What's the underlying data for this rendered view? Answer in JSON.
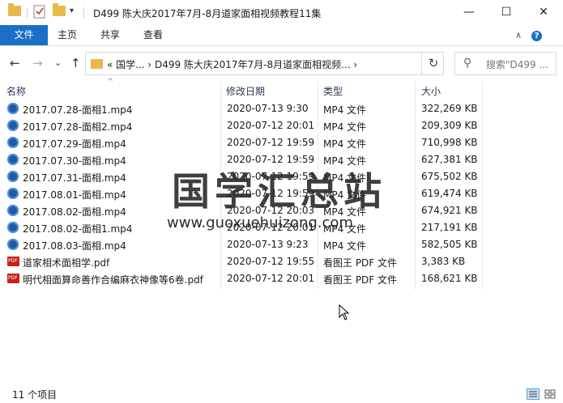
{
  "window": {
    "title": "D499 陈大庆2017年7月-8月道家面相视频教程11集",
    "minimize": "—",
    "maximize": "☐",
    "close": "✕"
  },
  "ribbon": {
    "file_tab": "文件",
    "tabs": [
      "主页",
      "共享",
      "查看"
    ]
  },
  "nav": {
    "back": "←",
    "forward": "→",
    "recent": "⌄",
    "up": "↑",
    "address": "«  国学...  ›  D499 陈大庆2017年7月-8月道家面相视频...  ›",
    "refresh": "↻",
    "search_placeholder": "搜索\"D499 ..."
  },
  "columns": {
    "name": "名称",
    "date": "修改日期",
    "type": "类型",
    "size": "大小"
  },
  "files": [
    {
      "name": "2017.07.28-面相1.mp4",
      "date": "2020-07-13 9:30",
      "type": "MP4 文件",
      "size": "322,269 KB",
      "kind": "mp4"
    },
    {
      "name": "2017.07.28-面相2.mp4",
      "date": "2020-07-12 20:01",
      "type": "MP4 文件",
      "size": "209,309 KB",
      "kind": "mp4"
    },
    {
      "name": "2017.07.29-面相.mp4",
      "date": "2020-07-12 19:59",
      "type": "MP4 文件",
      "size": "710,998 KB",
      "kind": "mp4"
    },
    {
      "name": "2017.07.30-面相.mp4",
      "date": "2020-07-12 19:59",
      "type": "MP4 文件",
      "size": "627,381 KB",
      "kind": "mp4"
    },
    {
      "name": "2017.07.31-面相.mp4",
      "date": "2020-07-12 19:59",
      "type": "MP4 文件",
      "size": "675,502 KB",
      "kind": "mp4"
    },
    {
      "name": "2017.08.01-面相.mp4",
      "date": "2020-07-12 19:59",
      "type": "MP4 文件",
      "size": "619,474 KB",
      "kind": "mp4"
    },
    {
      "name": "2017.08.02-面相.mp4",
      "date": "2020-07-12 20:03",
      "type": "MP4 文件",
      "size": "674,921 KB",
      "kind": "mp4"
    },
    {
      "name": "2017.08.02-面相1.mp4",
      "date": "2020-07-12 20:01",
      "type": "MP4 文件",
      "size": "217,191 KB",
      "kind": "mp4"
    },
    {
      "name": "2017.08.03-面相.mp4",
      "date": "2020-07-13 9:23",
      "type": "MP4 文件",
      "size": "582,505 KB",
      "kind": "mp4"
    },
    {
      "name": "道家相术面相学.pdf",
      "date": "2020-07-12 19:55",
      "type": "看图王 PDF 文件",
      "size": "3,383 KB",
      "kind": "pdf"
    },
    {
      "name": "明代相面算命善作合编麻衣神像等6卷.pdf",
      "date": "2020-07-12 20:01",
      "type": "看图王 PDF 文件",
      "size": "168,621 KB",
      "kind": "pdf"
    }
  ],
  "watermark": {
    "text": "国学汇总站",
    "url": "www.guoxuehuizong.com"
  },
  "status": {
    "count": "11 个项目"
  }
}
